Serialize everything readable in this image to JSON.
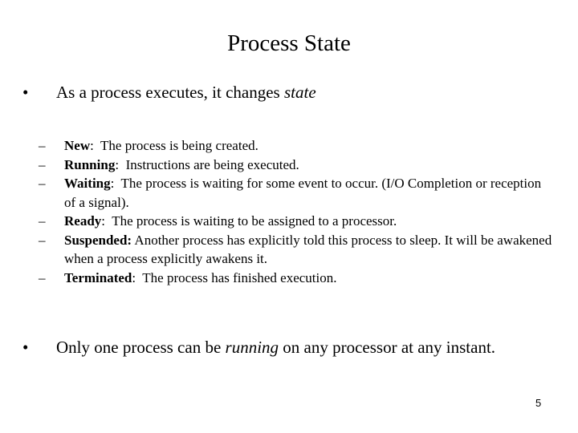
{
  "slide": {
    "title": "Process State",
    "bullet_char": "•",
    "dash_char": "–",
    "bullet1": {
      "text": "As a process executes, it changes ",
      "emphasis": "state"
    },
    "states": [
      {
        "name": "New",
        "sep": ":",
        "desc": "  The process is being created."
      },
      {
        "name": "Running",
        "sep": ":",
        "desc": "  Instructions are being executed."
      },
      {
        "name": "Waiting",
        "sep": ":",
        "desc": "  The process is waiting for some event to occur. (I/O Completion or reception of a signal)."
      },
      {
        "name": "Ready",
        "sep": ":",
        "desc": "  The process is waiting to be assigned to a processor."
      },
      {
        "name": "Suspended:",
        "sep": "",
        "desc": " Another process has explicitly told this process to sleep. It will be awakened when a process explicitly awakens it."
      },
      {
        "name": "Terminated",
        "sep": ":",
        "desc": "  The process has finished execution."
      }
    ],
    "bullet2": {
      "before": "Only one process can be ",
      "emphasis": "running",
      "after": " on any processor at any instant."
    },
    "page_number": "5"
  }
}
